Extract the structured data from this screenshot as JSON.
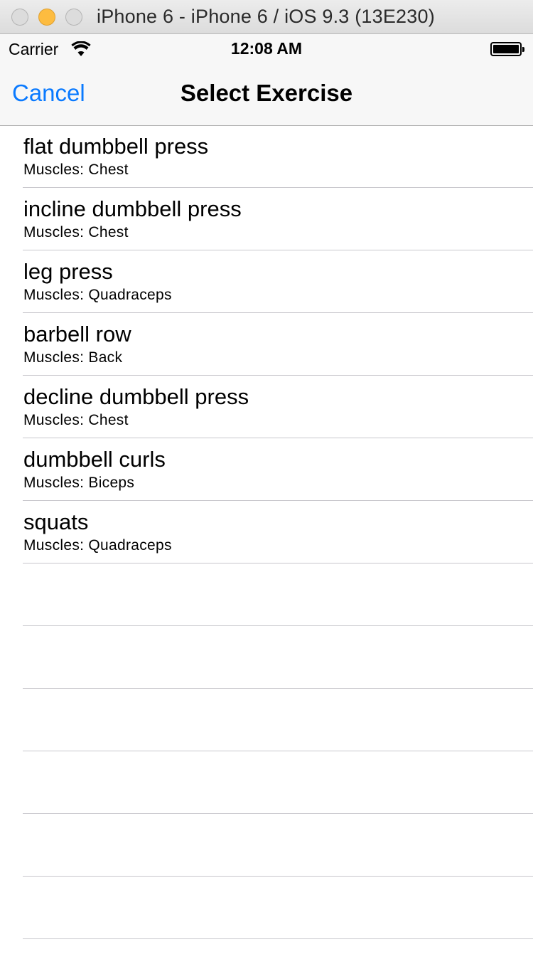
{
  "window": {
    "title": "iPhone 6 - iPhone 6 / iOS 9.3 (13E230)"
  },
  "status_bar": {
    "carrier": "Carrier",
    "time": "12:08 AM"
  },
  "nav": {
    "cancel_label": "Cancel",
    "title": "Select Exercise"
  },
  "exercises": [
    {
      "name": "flat dumbbell press",
      "muscles": "Muscles: Chest"
    },
    {
      "name": "incline dumbbell press",
      "muscles": "Muscles: Chest"
    },
    {
      "name": "leg press",
      "muscles": "Muscles: Quadraceps"
    },
    {
      "name": "barbell row",
      "muscles": "Muscles: Back"
    },
    {
      "name": "decline dumbbell press",
      "muscles": "Muscles: Chest"
    },
    {
      "name": "dumbbell curls",
      "muscles": "Muscles: Biceps"
    },
    {
      "name": "squats",
      "muscles": "Muscles: Quadraceps"
    }
  ],
  "colors": {
    "accent": "#0a7aff",
    "separator": "#c8c7cc",
    "bar_background": "#f7f7f7"
  },
  "icons": {
    "wifi": "wifi-icon",
    "battery": "battery-icon"
  }
}
